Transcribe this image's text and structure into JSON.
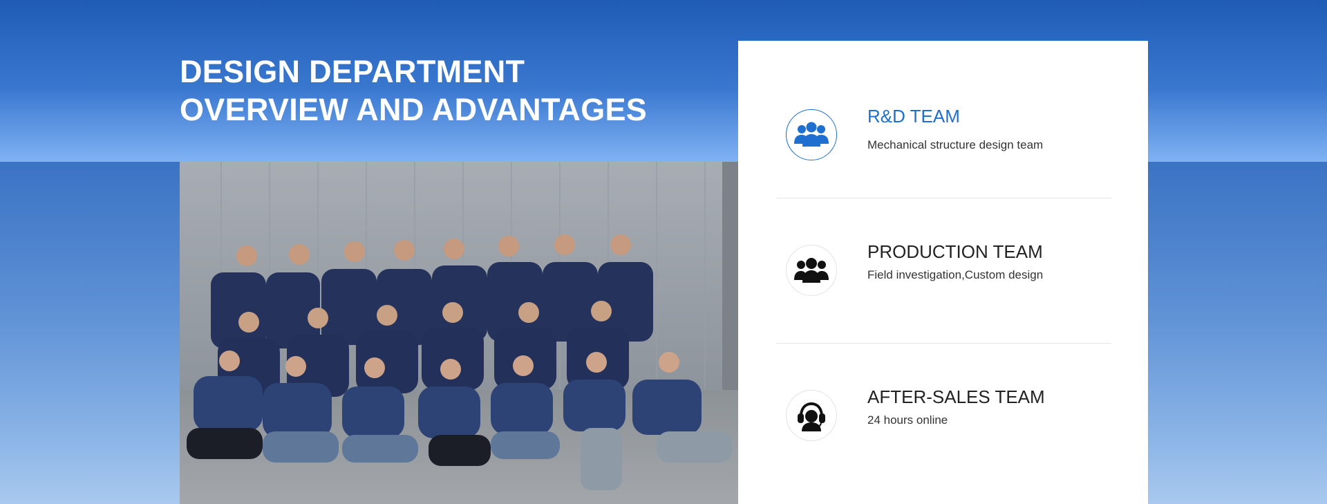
{
  "section": {
    "title_line1": "DESIGN DEPARTMENT",
    "title_line2": "OVERVIEW AND ADVANTAGES"
  },
  "photo": {
    "subject": "team-group-photo"
  },
  "teams": [
    {
      "title": "R&D TEAM",
      "description": "Mechanical structure design team",
      "icon": "team-people-icon",
      "accent": "#1e6fd0"
    },
    {
      "title": "PRODUCTION TEAM",
      "description": "Field investigation,Custom design",
      "icon": "group-icon",
      "accent": "#111111"
    },
    {
      "title": "AFTER-SALES TEAM",
      "description": "24 hours online",
      "icon": "headset-support-icon",
      "accent": "#111111"
    }
  ],
  "colors": {
    "background_top": "#1f5cb6",
    "accent_blue": "#1e6fd0",
    "panel_bg": "#ffffff"
  }
}
